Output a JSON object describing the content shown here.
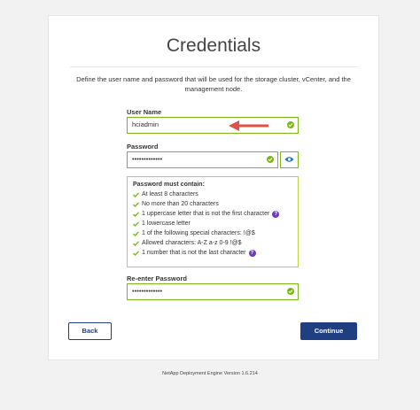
{
  "title": "Credentials",
  "description": "Define the user name and password that will be used for the storage cluster, vCenter, and the management node.",
  "username": {
    "label": "User Name",
    "value": "hciadmin"
  },
  "password": {
    "label": "Password",
    "value": "•••••••••••••"
  },
  "reenter": {
    "label": "Re-enter Password",
    "value": "•••••••••••••"
  },
  "rules": {
    "title": "Password must contain:",
    "items": [
      "At least 8 characters",
      "No more than 20 characters",
      "1 uppercase letter that is not the first character",
      "1 lowercase letter",
      "1 of the following special characters: !@$",
      "Allowed characters: A-Z a-z 0-9 !@$",
      "1 number that is not the last character"
    ],
    "help": "?"
  },
  "buttons": {
    "back": "Back",
    "continue": "Continue"
  },
  "footer": "NetApp Deployment Engine Version 1.6.214",
  "colors": {
    "valid": "#7cb518",
    "primary": "#1f3f82",
    "help": "#6c3dbf",
    "arrow": "#e0504a"
  }
}
